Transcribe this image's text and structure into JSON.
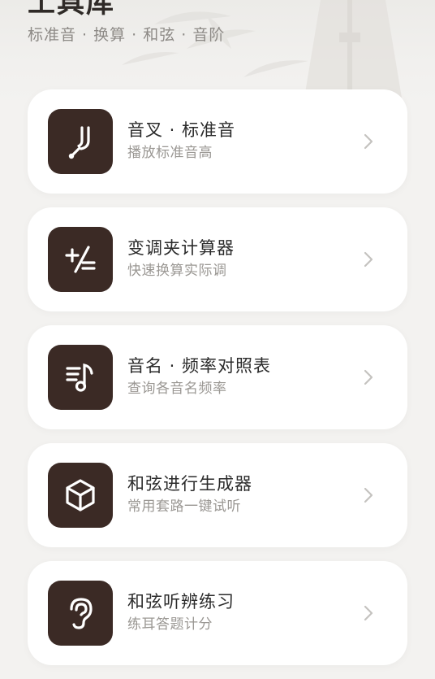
{
  "header": {
    "title": "工具库",
    "subtitle": "标准音 · 换算 · 和弦 · 音阶"
  },
  "tools": [
    {
      "title": "音叉 · 标准音",
      "subtitle": "播放标准音高",
      "icon": "tuning-fork-icon"
    },
    {
      "title": "变调夹计算器",
      "subtitle": "快速换算实际调",
      "icon": "plus-equals-icon"
    },
    {
      "title": "音名 · 频率对照表",
      "subtitle": "查询各音名频率",
      "icon": "music-list-icon"
    },
    {
      "title": "和弦进行生成器",
      "subtitle": "常用套路一键试听",
      "icon": "cube-icon"
    },
    {
      "title": "和弦听辨练习",
      "subtitle": "练耳答题计分",
      "icon": "ear-icon"
    }
  ],
  "colors": {
    "background": "#f3f2f0",
    "card": "#ffffff",
    "icon_tile": "#3b2a25",
    "title_text": "#2b2b2b",
    "subtitle_text": "#9a9793"
  }
}
